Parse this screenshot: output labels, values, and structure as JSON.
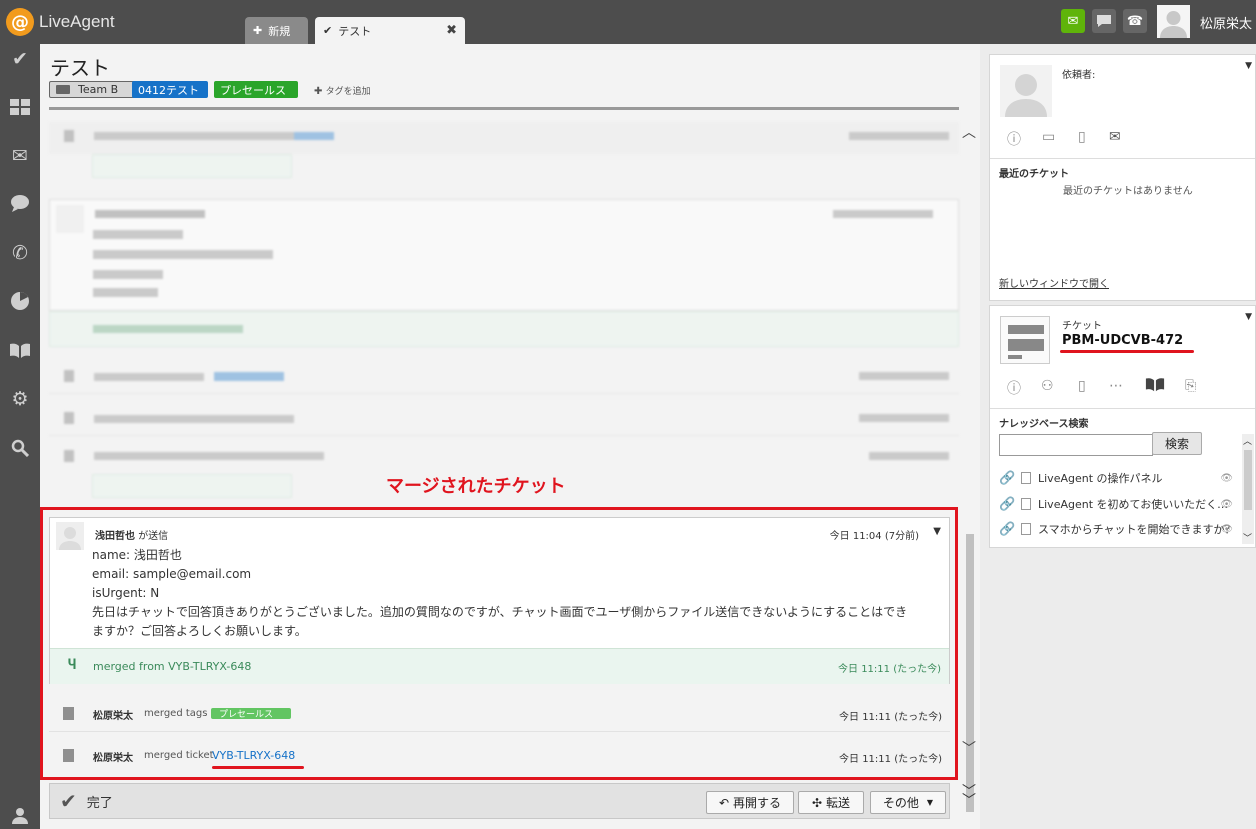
{
  "app": {
    "name": "LiveAgent",
    "logo_glyph": "@",
    "user": "松原栄太"
  },
  "tabs": [
    {
      "label": "新規",
      "icon": "plus-icon"
    },
    {
      "label": "テスト",
      "icon": "check-icon",
      "close": "✖"
    }
  ],
  "ticket": {
    "title": "テスト",
    "tags": {
      "team": "Team B",
      "tag1": "0412テスト",
      "tag2": "プレセールス"
    },
    "add_tag": "タグを追加"
  },
  "annotation": "マージされたチケット",
  "message": {
    "sender": "浅田哲也",
    "sent_label": "が送信",
    "time": "今日 11:04 (7分前)",
    "lines": [
      "name: 浅田哲也",
      "email: sample@email.com",
      "isUrgent: N",
      "先日はチャットで回答頂きありがとうございました。追加の質問なのですが、チャット画面でユーザ側からファイル送信できないようにすることはでき",
      "ますか？ご回答よろしくお願いします。"
    ],
    "merged_text": "merged from VYB-TLRYX-648",
    "merged_time": "今日 11:11 (たった今)"
  },
  "events": [
    {
      "who": "松原栄太",
      "action": "merged tags",
      "tag": "プレセールス",
      "time": "今日 11:11 (たった今)"
    },
    {
      "who": "松原栄太",
      "action": "merged ticket",
      "ticket": "VYB-TLRYX-648",
      "time": "今日 11:11 (たった今)"
    }
  ],
  "actions": {
    "done": "完了",
    "reopen": "再開する",
    "transfer": "転送",
    "other": "その他"
  },
  "requester": {
    "label": "依頼者:",
    "recent_title": "最近のチケット",
    "recent_empty": "最近のチケットはありません",
    "new_window": "新しいウィンドウで開く"
  },
  "ticket_panel": {
    "label": "チケット",
    "code": "PBM-UDCVB-472",
    "kb_title": "ナレッジベース検索",
    "search_btn": "検索",
    "search_value": "",
    "kb_items": [
      "LiveAgent の操作パネル",
      "LiveAgent を初めてお使いいただく…",
      "スマホからチャットを開始できますか？"
    ]
  },
  "colors": {
    "accent_red": "#e0141e",
    "logo": "#f29b1d",
    "tag_blue": "#1672c8",
    "tag_green": "#2aa52a"
  }
}
